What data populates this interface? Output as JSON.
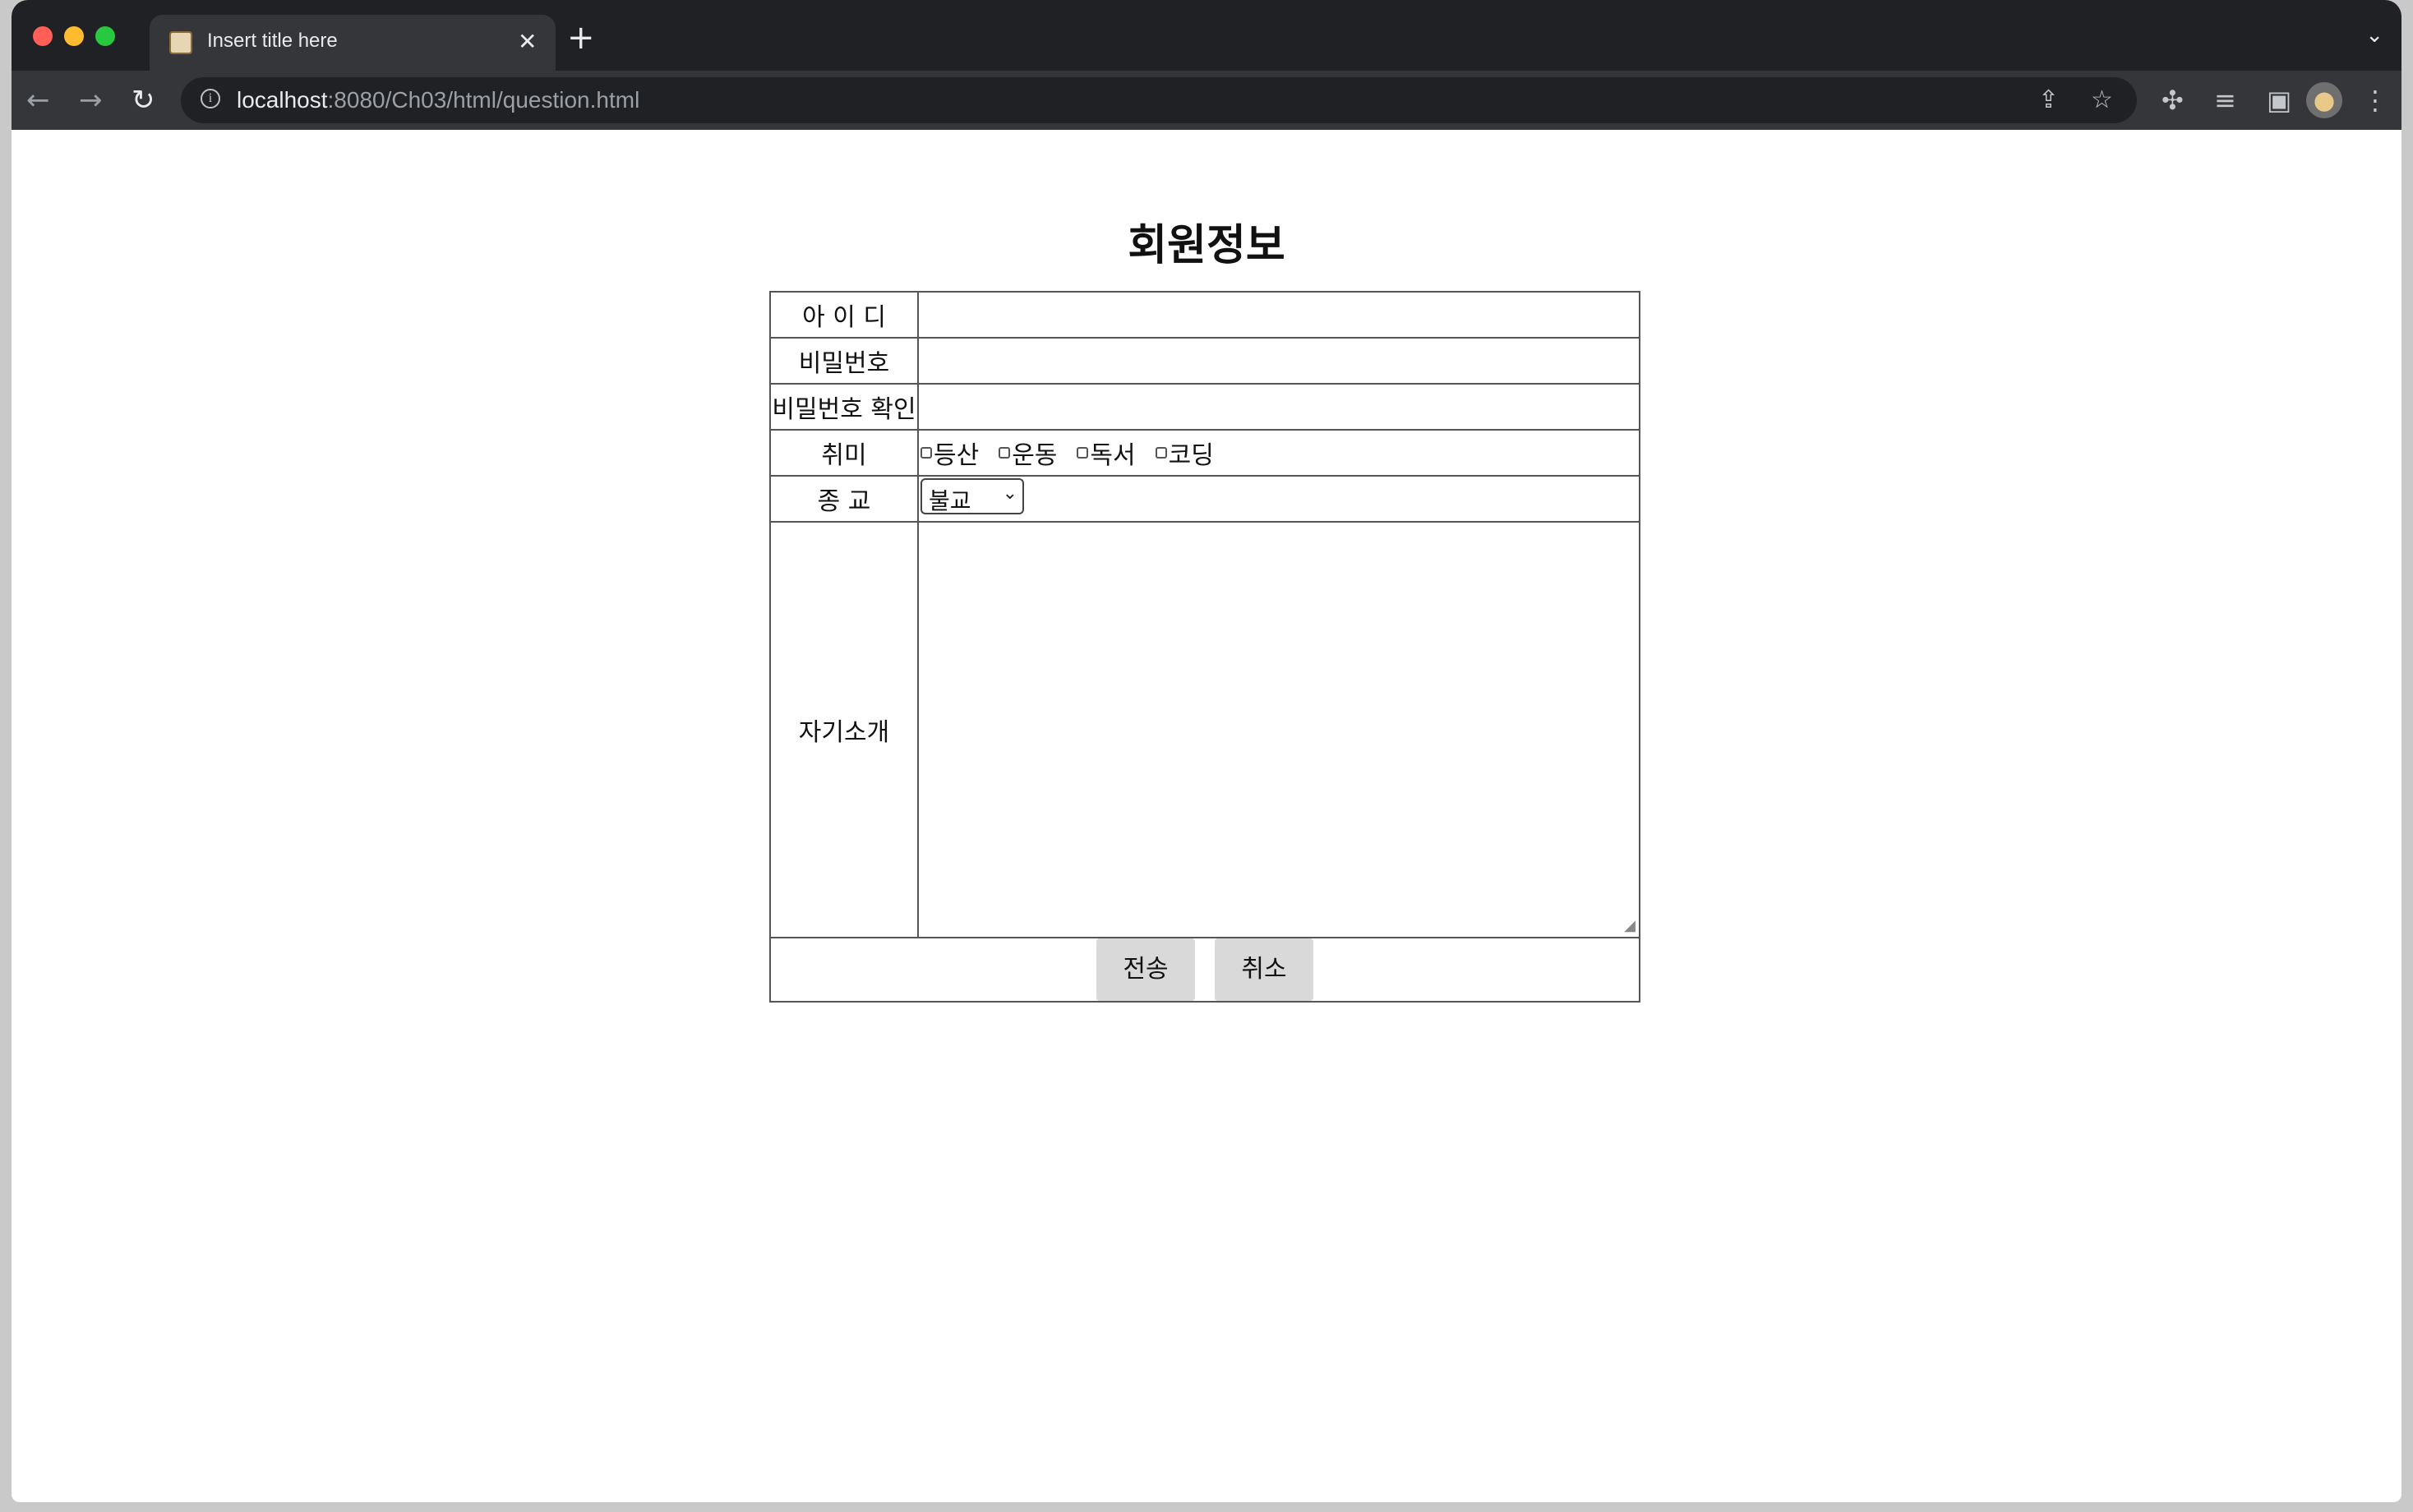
{
  "browser": {
    "tab_title": "Insert title here",
    "tab_close": "✕",
    "new_tab": "+",
    "tab_list": "⌄",
    "url_host": "localhost",
    "url_rest": ":8080/Ch03/html/question.html",
    "icons": {
      "back": "←",
      "forward": "→",
      "reload": "↻",
      "info": "i",
      "share": "⇪",
      "star": "☆",
      "extensions": "✣",
      "media": "≡",
      "side_panel": "▣",
      "menu": "⋮"
    }
  },
  "page": {
    "title": "회원정보",
    "labels": {
      "id": "아 이 디",
      "password": "비밀번호",
      "password_confirm": "비밀번호 확인",
      "hobby": "취미",
      "religion": "종 교",
      "intro": "자기소개"
    },
    "hobbies": [
      "등산",
      "운동",
      "독서",
      "코딩"
    ],
    "religion_selected": "불교",
    "select_chevron": "⌄",
    "resize_grip": "◢",
    "buttons": {
      "submit": "전송",
      "cancel": "취소"
    }
  }
}
